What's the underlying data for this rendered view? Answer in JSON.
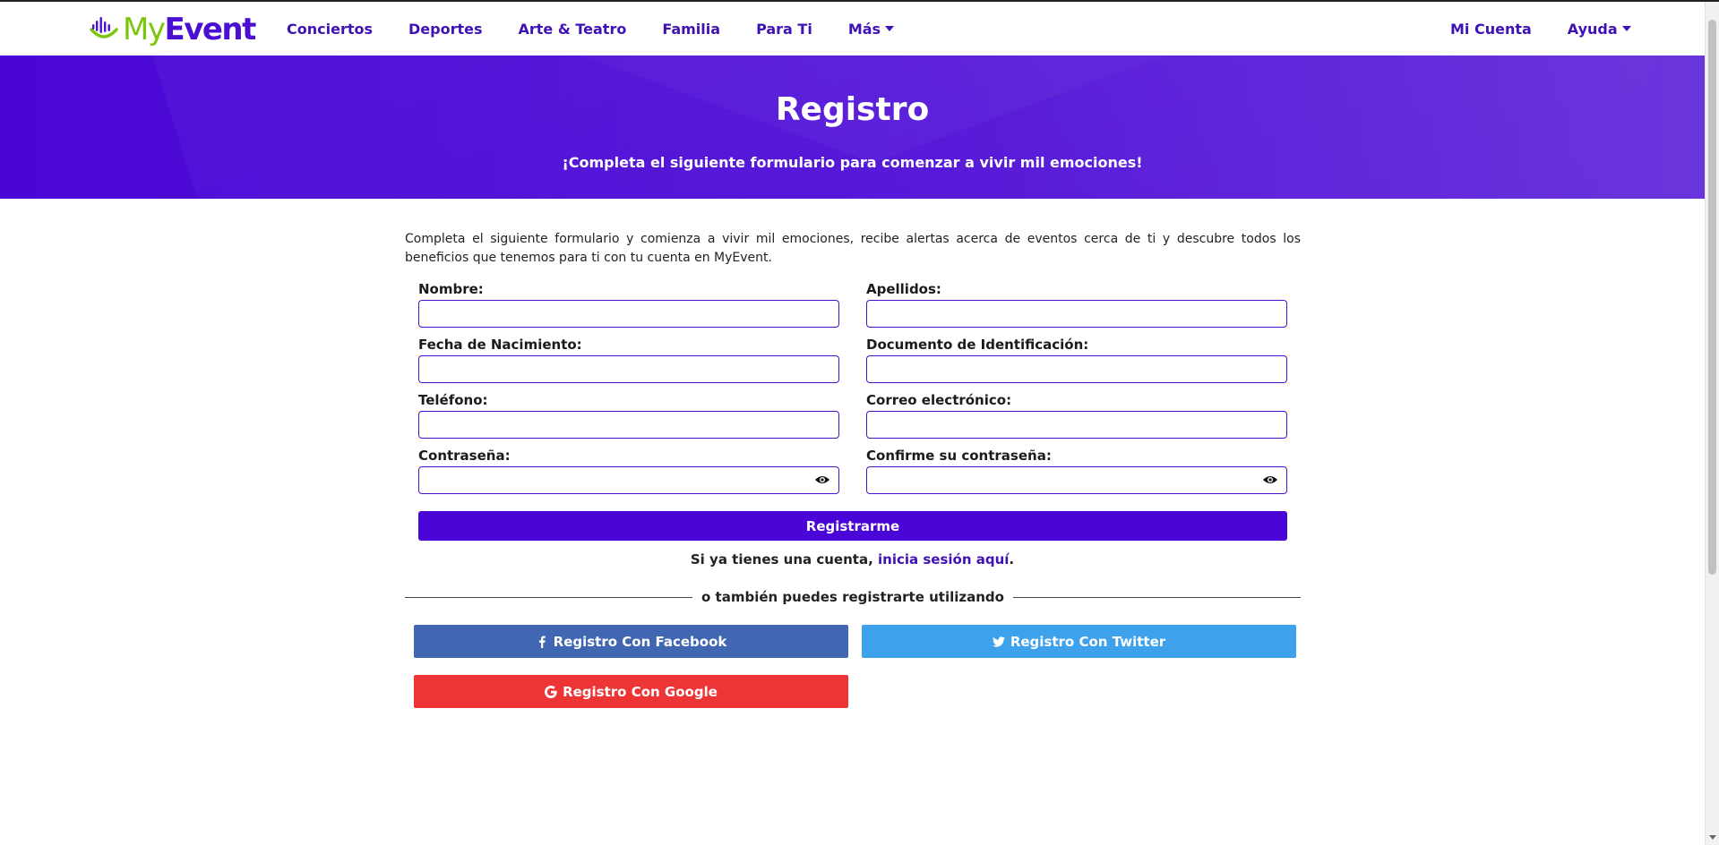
{
  "brand": {
    "my": "My",
    "event": "Event"
  },
  "nav": {
    "items": [
      {
        "label": "Conciertos"
      },
      {
        "label": "Deportes"
      },
      {
        "label": "Arte & Teatro"
      },
      {
        "label": "Familia"
      },
      {
        "label": "Para Ti"
      },
      {
        "label": "Más"
      }
    ],
    "right": [
      {
        "label": "Mi Cuenta"
      },
      {
        "label": "Ayuda"
      }
    ]
  },
  "hero": {
    "title": "Registro",
    "subtitle": "¡Completa el siguiente formulario para comenzar a vivir mil emociones!"
  },
  "intro": "Completa el siguiente formulario y comienza a vivir mil emociones, recibe alertas acerca de eventos cerca de ti y descubre todos los beneficios que tenemos para ti con tu cuenta en MyEvent.",
  "form": {
    "nombre": {
      "label": "Nombre:",
      "value": ""
    },
    "apellidos": {
      "label": "Apellidos:",
      "value": ""
    },
    "fecha": {
      "label": "Fecha de Nacimiento:",
      "value": ""
    },
    "documento": {
      "label": "Documento de Identificación:",
      "value": ""
    },
    "telefono": {
      "label": "Teléfono:",
      "value": ""
    },
    "correo": {
      "label": "Correo electrónico:",
      "value": ""
    },
    "password": {
      "label": "Contraseña:",
      "value": ""
    },
    "confirm": {
      "label": "Confirme su contraseña:",
      "value": ""
    },
    "submit": "Registrarme"
  },
  "login": {
    "prefix": "Si ya tienes una cuenta, ",
    "link": "inicia sesión aquí",
    "suffix": "."
  },
  "divider": "o también puedes registrarte utilizando",
  "social": {
    "facebook": {
      "label": "Registro Con Facebook",
      "color": "#4267b2",
      "icon": "facebook-icon"
    },
    "twitter": {
      "label": "Registro Con Twitter",
      "color": "#3ea1ec",
      "icon": "twitter-icon"
    },
    "google": {
      "label": "Registro Con Google",
      "color": "#ee3535",
      "icon": "google-icon"
    }
  },
  "colors": {
    "primary": "#4a06d6",
    "nav_text": "#3e12b5",
    "logo_green": "#7ac70c"
  }
}
